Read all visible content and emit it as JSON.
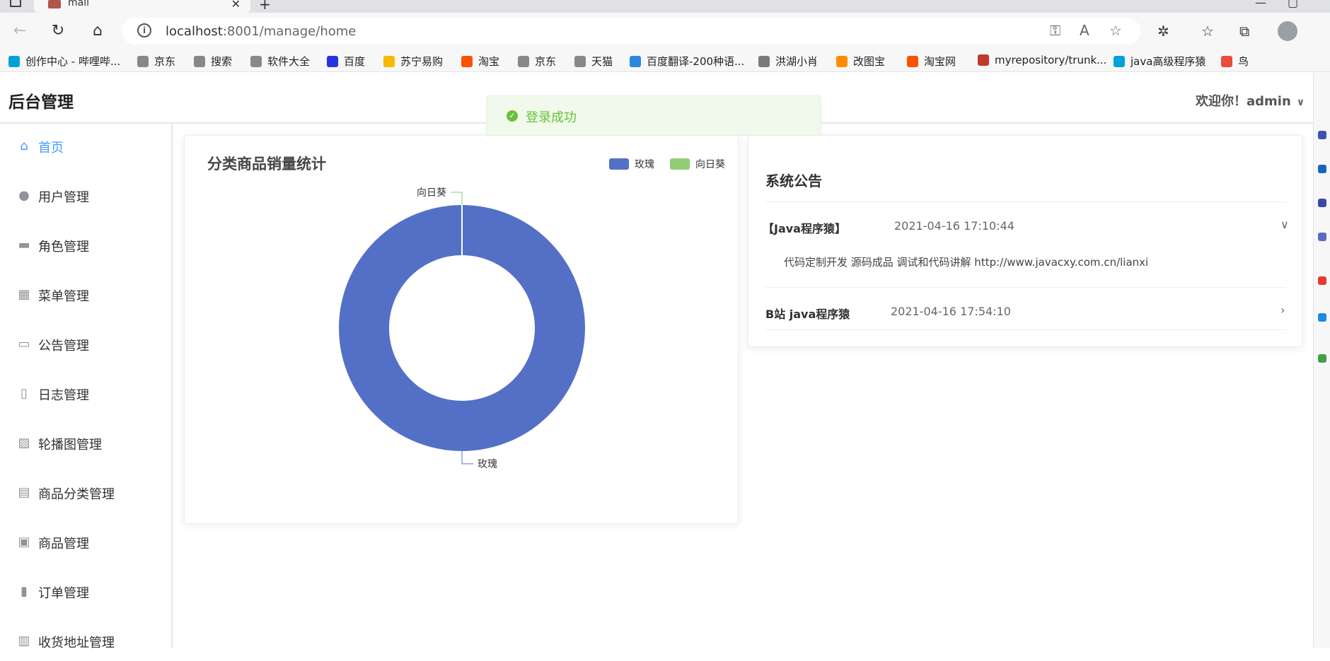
{
  "browser": {
    "tab_title": "mall",
    "url_host": "localhost",
    "url_rest": ":8001/manage/home",
    "bookmarks": [
      {
        "label": "创作中心 - 哔哩哔...",
        "color": "#00a1d6"
      },
      {
        "label": "京东",
        "color": "#888888"
      },
      {
        "label": "搜索",
        "color": "#888888"
      },
      {
        "label": "软件大全",
        "color": "#888888"
      },
      {
        "label": "百度",
        "color": "#2932e1"
      },
      {
        "label": "苏宁易购",
        "color": "#f5b900"
      },
      {
        "label": "淘宝",
        "color": "#ff5000"
      },
      {
        "label": "京东",
        "color": "#888888"
      },
      {
        "label": "天猫",
        "color": "#888888"
      },
      {
        "label": "百度翻译-200种语...",
        "color": "#2e86de"
      },
      {
        "label": "洪湖小肖",
        "color": "#7a7a7a"
      },
      {
        "label": "改图宝",
        "color": "#ff8c00"
      },
      {
        "label": "淘宝网",
        "color": "#ff5000"
      },
      {
        "label": "myrepository/trunk...",
        "color": "#c0392b"
      },
      {
        "label": "java高级程序猿",
        "color": "#00a1d6"
      },
      {
        "label": "鸟",
        "color": "#e74c3c"
      }
    ]
  },
  "header": {
    "title": "后台管理",
    "user": "欢迎你！admin"
  },
  "toast": {
    "text": "登录成功"
  },
  "menu": [
    {
      "label": "首页",
      "icon": "home-icon",
      "glyph": "⌂",
      "active": true
    },
    {
      "label": "用户管理",
      "icon": "user-icon",
      "glyph": "●",
      "active": false
    },
    {
      "label": "角色管理",
      "icon": "briefcase-icon",
      "glyph": "▬",
      "active": false
    },
    {
      "label": "菜单管理",
      "icon": "grid-icon",
      "glyph": "▦",
      "active": false
    },
    {
      "label": "公告管理",
      "icon": "presentation-icon",
      "glyph": "▭",
      "active": false
    },
    {
      "label": "日志管理",
      "icon": "notebook-icon",
      "glyph": "▯",
      "active": false
    },
    {
      "label": "轮播图管理",
      "icon": "picture-icon",
      "glyph": "▨",
      "active": false
    },
    {
      "label": "商品分类管理",
      "icon": "document-icon",
      "glyph": "▤",
      "active": false
    },
    {
      "label": "商品管理",
      "icon": "shopping-bag-icon",
      "glyph": "▣",
      "active": false
    },
    {
      "label": "订单管理",
      "icon": "bar-chart-icon",
      "glyph": "▮",
      "active": false
    },
    {
      "label": "收货地址管理",
      "icon": "location-icon",
      "glyph": "▥",
      "active": false
    }
  ],
  "notice": {
    "title": "系统公告",
    "items": [
      {
        "title": "【Java程序猿】",
        "time": "2021-04-16 17:10:44",
        "expanded": true,
        "body": "代码定制开发 源码成品 调试和代码讲解 http://www.javacxy.com.cn/lianxi"
      },
      {
        "title": "B站 java程序猿",
        "time": "2021-04-16 17:54:10",
        "expanded": false,
        "body": ""
      }
    ]
  },
  "chart_data": {
    "type": "pie",
    "variant": "donut",
    "title": "分类商品销量统计",
    "legend": "top-right",
    "series": [
      {
        "name": "玫瑰",
        "value": 100,
        "color": "#5470c6"
      },
      {
        "name": "向日葵",
        "value": 0,
        "color": "#91cc75"
      }
    ]
  }
}
